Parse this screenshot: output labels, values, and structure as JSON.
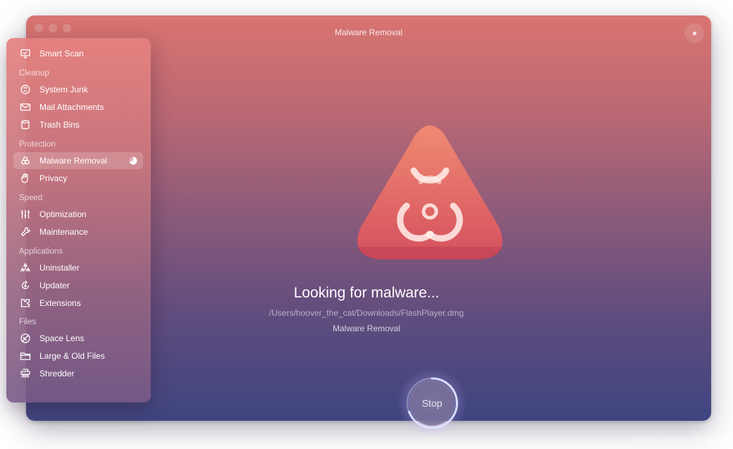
{
  "window": {
    "title": "Malware Removal"
  },
  "sidebar": {
    "smart_scan": "Smart Scan",
    "cleanup": {
      "heading": "Cleanup",
      "items": [
        "System Junk",
        "Mail Attachments",
        "Trash Bins"
      ]
    },
    "protection": {
      "heading": "Protection",
      "items": [
        "Malware Removal",
        "Privacy"
      ],
      "active": "Malware Removal"
    },
    "speed": {
      "heading": "Speed",
      "items": [
        "Optimization",
        "Maintenance"
      ]
    },
    "applications": {
      "heading": "Applications",
      "items": [
        "Uninstaller",
        "Updater",
        "Extensions"
      ]
    },
    "files": {
      "heading": "Files",
      "items": [
        "Space Lens",
        "Large & Old Files",
        "Shredder"
      ]
    }
  },
  "main": {
    "status": "Looking for malware...",
    "path": "/Users/hoover_the_cat/Downloads/FlashPlayer.dmg",
    "module": "Malware Removal",
    "hero_icon": "biohazard-icon",
    "stop_label": "Stop"
  },
  "colors": {
    "gradient_top": "#d97470",
    "gradient_bottom": "#3f4580",
    "hero_top": "#f08a72",
    "hero_bottom": "#d5505e"
  },
  "watermark": "CSDN @CoCo玩电脑"
}
